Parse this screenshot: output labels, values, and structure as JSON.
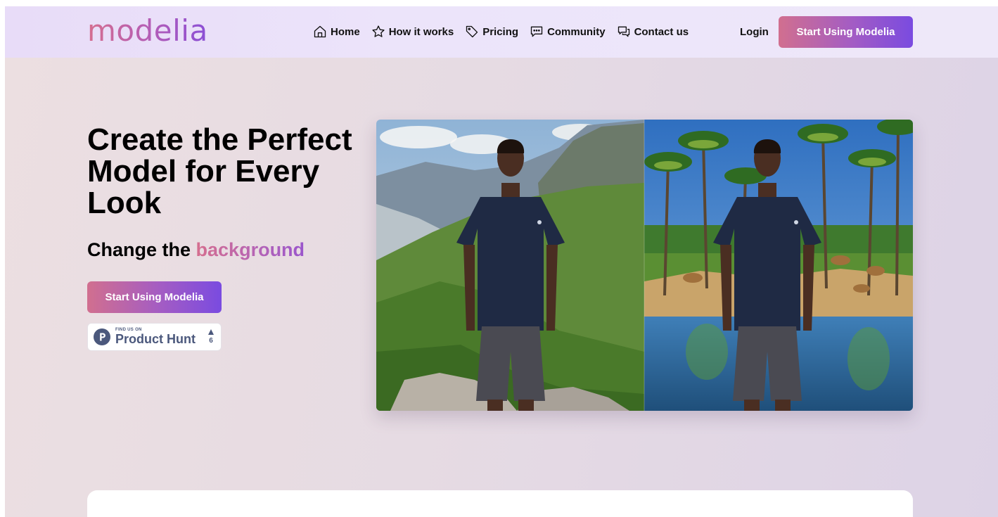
{
  "brand": {
    "logo_text": "modelia"
  },
  "nav": {
    "links": [
      {
        "label": "Home",
        "icon": "home-icon"
      },
      {
        "label": "How it works",
        "icon": "star-icon"
      },
      {
        "label": "Pricing",
        "icon": "tag-icon"
      },
      {
        "label": "Community",
        "icon": "chat-icon"
      },
      {
        "label": "Contact us",
        "icon": "chat-bubbles-icon"
      }
    ],
    "login_label": "Login",
    "cta_label": "Start Using Modelia"
  },
  "hero": {
    "title": "Create the Perfect Model for Every Look",
    "subtitle_prefix": "Change the",
    "subtitle_accent": "background",
    "cta_label": "Start Using Modelia",
    "product_hunt": {
      "small_text": "FIND US ON",
      "big_text": "Product Hunt",
      "votes": "6"
    },
    "image": {
      "left_scene": "mountain-landscape",
      "right_scene": "palm-oasis-with-camels",
      "subject": "man-in-navy-tshirt-and-grey-shorts"
    }
  },
  "colors": {
    "gradient_start": "#d16f8f",
    "gradient_end": "#7a4be0",
    "product_hunt_slate": "#4b587c"
  }
}
